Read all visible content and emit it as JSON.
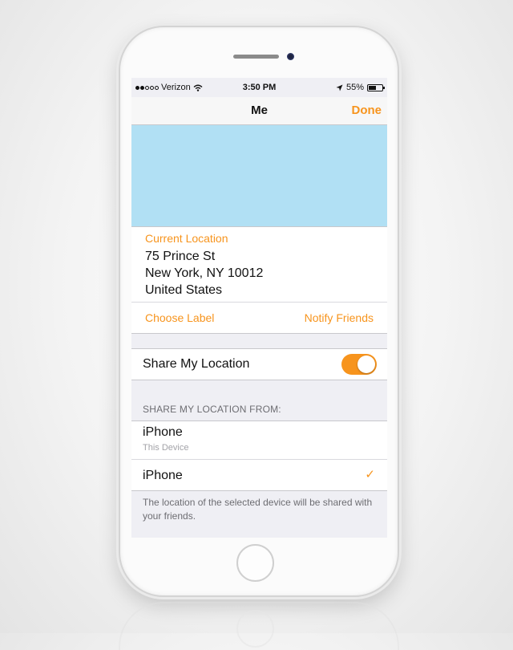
{
  "status_bar": {
    "carrier": "Verizon",
    "time": "3:50 PM",
    "battery": "55%"
  },
  "nav": {
    "title": "Me",
    "done": "Done"
  },
  "location": {
    "label": "Current Location",
    "line1": "75 Prince St",
    "line2": "New York, NY  10012",
    "line3": "United States"
  },
  "actions": {
    "choose_label": "Choose Label",
    "notify_friends": "Notify Friends"
  },
  "share": {
    "label": "Share My Location",
    "enabled": true
  },
  "devices": {
    "header": "SHARE MY LOCATION FROM:",
    "items": [
      {
        "name": "iPhone",
        "subtitle": "This Device",
        "selected": false
      },
      {
        "name": "iPhone",
        "subtitle": "",
        "selected": true
      }
    ],
    "checkmark": "✓",
    "footer": "The location of the selected device will be shared with your friends."
  },
  "colors": {
    "accent": "#f7941d",
    "map": "#b1e0f4",
    "group_background": "#efeff4"
  }
}
